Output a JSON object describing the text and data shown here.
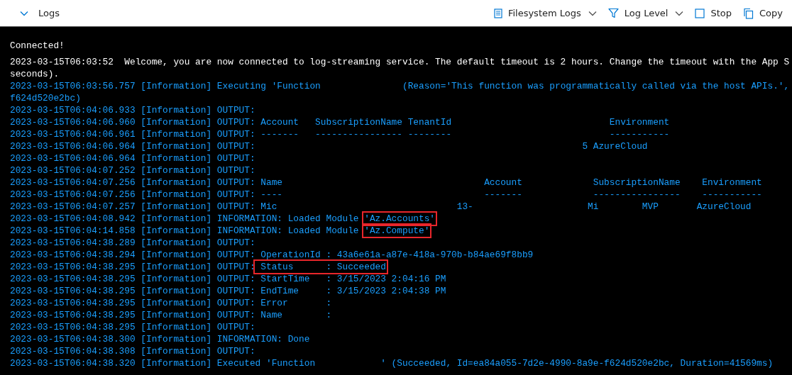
{
  "header": {
    "title": "Logs",
    "actions": [
      {
        "kind": "document",
        "label": "Filesystem Logs",
        "dropdown": true
      },
      {
        "kind": "filter",
        "label": "Log Level",
        "dropdown": true
      },
      {
        "kind": "stop",
        "label": "Stop",
        "dropdown": false
      },
      {
        "kind": "copy",
        "label": "Copy",
        "dropdown": false
      }
    ]
  },
  "console": {
    "status": "Connected!",
    "lines": [
      {
        "kind": "system",
        "text": "2023-03-15T06:03:52  Welcome, you are now connected to log-streaming service. The default timeout is 2 hours. Change the timeout with the App S"
      },
      {
        "kind": "system",
        "text": "seconds)."
      },
      {
        "kind": "log",
        "time": "2023-03-15T06:03:56.757",
        "level": "[Information]",
        "segments": [
          {
            "text": "Executing 'Function               (Reason='This function was programmatically called via the host APIs.',"
          }
        ]
      },
      {
        "kind": "wrap",
        "text": "f624d520e2bc)"
      },
      {
        "kind": "log",
        "time": "2023-03-15T06:04:06.933",
        "level": "[Information]",
        "segments": [
          {
            "text": "OUTPUT:",
            "highlighted": false
          }
        ]
      },
      {
        "kind": "log",
        "time": "2023-03-15T06:04:06.960",
        "level": "[Information]",
        "segments": [
          {
            "text": "OUTPUT: Account   SubscriptionName TenantId                             Environment",
            "highlighted": false
          }
        ]
      },
      {
        "kind": "log",
        "time": "2023-03-15T06:04:06.961",
        "level": "[Information]",
        "segments": [
          {
            "text": "OUTPUT: -------   ---------------- --------                             -----------",
            "highlighted": false
          }
        ]
      },
      {
        "kind": "log",
        "time": "2023-03-15T06:04:06.964",
        "level": "[Information]",
        "segments": [
          {
            "text": "OUTPUT:                                                            5 AzureCloud",
            "highlighted": false
          }
        ]
      },
      {
        "kind": "log",
        "time": "2023-03-15T06:04:06.964",
        "level": "[Information]",
        "segments": [
          {
            "text": "OUTPUT:",
            "highlighted": false
          }
        ]
      },
      {
        "kind": "log",
        "time": "2023-03-15T06:04:07.252",
        "level": "[Information]",
        "segments": [
          {
            "text": "OUTPUT:",
            "highlighted": false
          }
        ]
      },
      {
        "kind": "log",
        "time": "2023-03-15T06:04:07.256",
        "level": "[Information]",
        "segments": [
          {
            "text": "OUTPUT: Name                                     Account             SubscriptionName    Environment",
            "highlighted": false
          }
        ]
      },
      {
        "kind": "log",
        "time": "2023-03-15T06:04:07.256",
        "level": "[Information]",
        "segments": [
          {
            "text": "OUTPUT: ----                                     -------             ----------------    -----------",
            "highlighted": false
          }
        ]
      },
      {
        "kind": "log",
        "time": "2023-03-15T06:04:07.257",
        "level": "[Information]",
        "segments": [
          {
            "text": "OUTPUT: Mic                                 13-                     Mi        MVP       AzureCloud",
            "highlighted": false
          }
        ]
      },
      {
        "kind": "log",
        "time": "2023-03-15T06:04:08.942",
        "level": "[Information]",
        "segments": [
          {
            "text": "INFORMATION: Loaded Module ",
            "highlighted": false
          },
          {
            "text": "'Az.Accounts'",
            "highlighted": true
          }
        ]
      },
      {
        "kind": "log",
        "time": "2023-03-15T06:04:14.858",
        "level": "[Information]",
        "segments": [
          {
            "text": "INFORMATION: Loaded Module ",
            "highlighted": false
          },
          {
            "text": "'Az.Compute'",
            "highlighted": true
          }
        ]
      },
      {
        "kind": "log",
        "time": "2023-03-15T06:04:38.289",
        "level": "[Information]",
        "segments": [
          {
            "text": "OUTPUT:",
            "highlighted": false
          }
        ]
      },
      {
        "kind": "log",
        "time": "2023-03-15T06:04:38.294",
        "level": "[Information]",
        "segments": [
          {
            "text": "OUTPUT: OperationId : 43a6e61a-a87e-418a-970b-b84ae69f8bb9",
            "highlighted": false
          }
        ]
      },
      {
        "kind": "log",
        "time": "2023-03-15T06:04:38.295",
        "level": "[Information]",
        "segments": [
          {
            "text": "OUTPUT:",
            "highlighted": false
          },
          {
            "text": " Status      : Succeeded",
            "highlighted": true
          }
        ]
      },
      {
        "kind": "log",
        "time": "2023-03-15T06:04:38.295",
        "level": "[Information]",
        "segments": [
          {
            "text": "OUTPUT: StartTime   : 3/15/2023 2:04:16 PM",
            "highlighted": false
          }
        ]
      },
      {
        "kind": "log",
        "time": "2023-03-15T06:04:38.295",
        "level": "[Information]",
        "segments": [
          {
            "text": "OUTPUT: EndTime     : 3/15/2023 2:04:38 PM",
            "highlighted": false
          }
        ]
      },
      {
        "kind": "log",
        "time": "2023-03-15T06:04:38.295",
        "level": "[Information]",
        "segments": [
          {
            "text": "OUTPUT: Error       :",
            "highlighted": false
          }
        ]
      },
      {
        "kind": "log",
        "time": "2023-03-15T06:04:38.295",
        "level": "[Information]",
        "segments": [
          {
            "text": "OUTPUT: Name        :",
            "highlighted": false
          }
        ]
      },
      {
        "kind": "log",
        "time": "2023-03-15T06:04:38.295",
        "level": "[Information]",
        "segments": [
          {
            "text": "OUTPUT:",
            "highlighted": false
          }
        ]
      },
      {
        "kind": "log",
        "time": "2023-03-15T06:04:38.300",
        "level": "[Information]",
        "segments": [
          {
            "text": "INFORMATION: Done",
            "highlighted": false
          }
        ]
      },
      {
        "kind": "log",
        "time": "2023-03-15T06:04:38.308",
        "level": "[Information]",
        "segments": [
          {
            "text": "OUTPUT:",
            "highlighted": false
          }
        ]
      },
      {
        "kind": "log",
        "time": "2023-03-15T06:04:38.320",
        "level": "[Information]",
        "segments": [
          {
            "text": "Executed 'Function            ' (Succeeded, Id=ea84a055-7d2e-4990-8a9e-f624d520e2bc, Duration=41569ms)",
            "highlighted": false
          }
        ]
      }
    ]
  }
}
